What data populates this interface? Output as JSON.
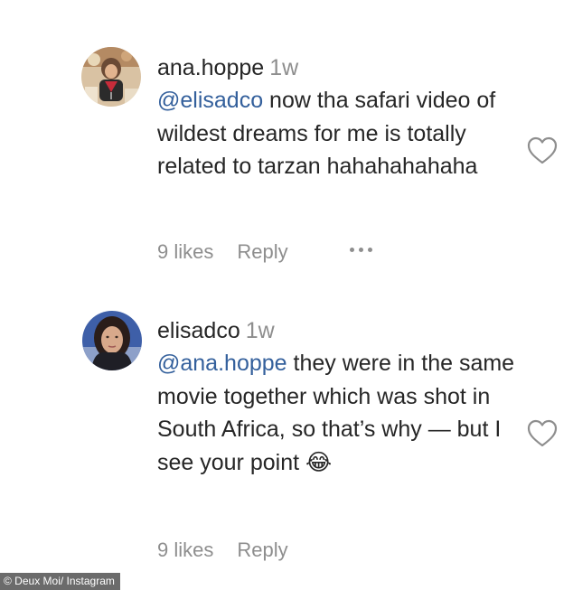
{
  "comments": [
    {
      "username": "ana.hoppe",
      "time": "1w",
      "mention": "@elisadco",
      "text": " now tha safari video of wildest dreams for me is totally related to tarzan hahahahahaha",
      "likes": "9 likes",
      "reply": "Reply",
      "avatar_icon": "profile-photo-ana",
      "like_icon": "heart-outline-icon"
    },
    {
      "username": "elisadco",
      "time": "1w",
      "mention": "@ana.hoppe",
      "text": " they were in the same movie together which was shot in South Africa, so that’s why — but I see your point ",
      "emoji": "😂",
      "likes": "9 likes",
      "reply": "Reply",
      "avatar_icon": "profile-photo-elisa",
      "like_icon": "heart-outline-icon"
    }
  ],
  "credit": "© Deux Moi/ Instagram",
  "colors": {
    "text": "#262626",
    "muted": "#8e8e8e",
    "mention": "#34609c"
  }
}
